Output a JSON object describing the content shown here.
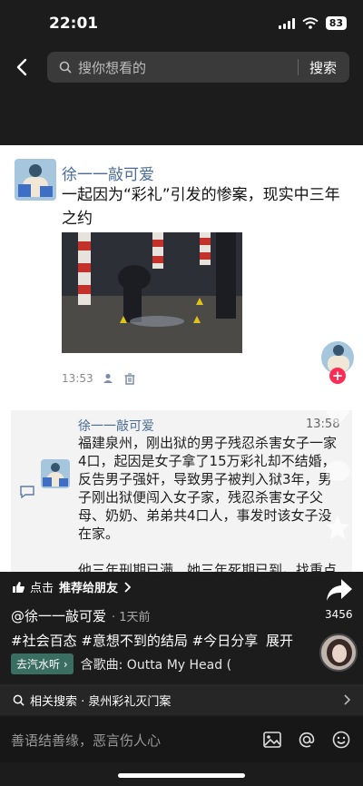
{
  "status": {
    "time": "22:01",
    "battery": "83"
  },
  "search": {
    "placeholder": "搜你想看的",
    "button": "搜索"
  },
  "post": {
    "username": "徐一一敲可爱",
    "text": "一起因为“彩礼”引发的惨案，现实中三年之约",
    "time": "13:53"
  },
  "comment": {
    "username": "徐一一敲可爱",
    "time": "13:58",
    "paragraphs": [
      "福建泉州，刚出狱的男子残忍杀害女子一家4口，起因是女子拿了15万彩礼却不结婚，反告男子强奸，导致男子被判入狱3年，男子刚出狱便闯入女子家，残忍杀害女子父母、奶奶、弟弟共4口人，事发时该女子没在家。",
      "他三年刑期已满，她三年死期已到。找重点"
    ]
  },
  "rail": {
    "share_count": "3456"
  },
  "bottom": {
    "recommend_prefix": "点击",
    "recommend": "推荐给朋友",
    "author": "@徐一一敲可爱",
    "author_sub": "· 1天前",
    "tags": "#社会百态 #意想不到的结局 #今日分享",
    "expand": "展开",
    "chip": "去汽水听",
    "music": "含歌曲: Outta My Head (",
    "related": "相关搜索 · 泉州彩礼灭门案",
    "comment_placeholder": "善语结善缘，恶言伤人心"
  },
  "colors": {
    "accent_pink": "#fe2c55",
    "link_blue": "#4a6c95",
    "chip_green": "#3b6e62"
  }
}
